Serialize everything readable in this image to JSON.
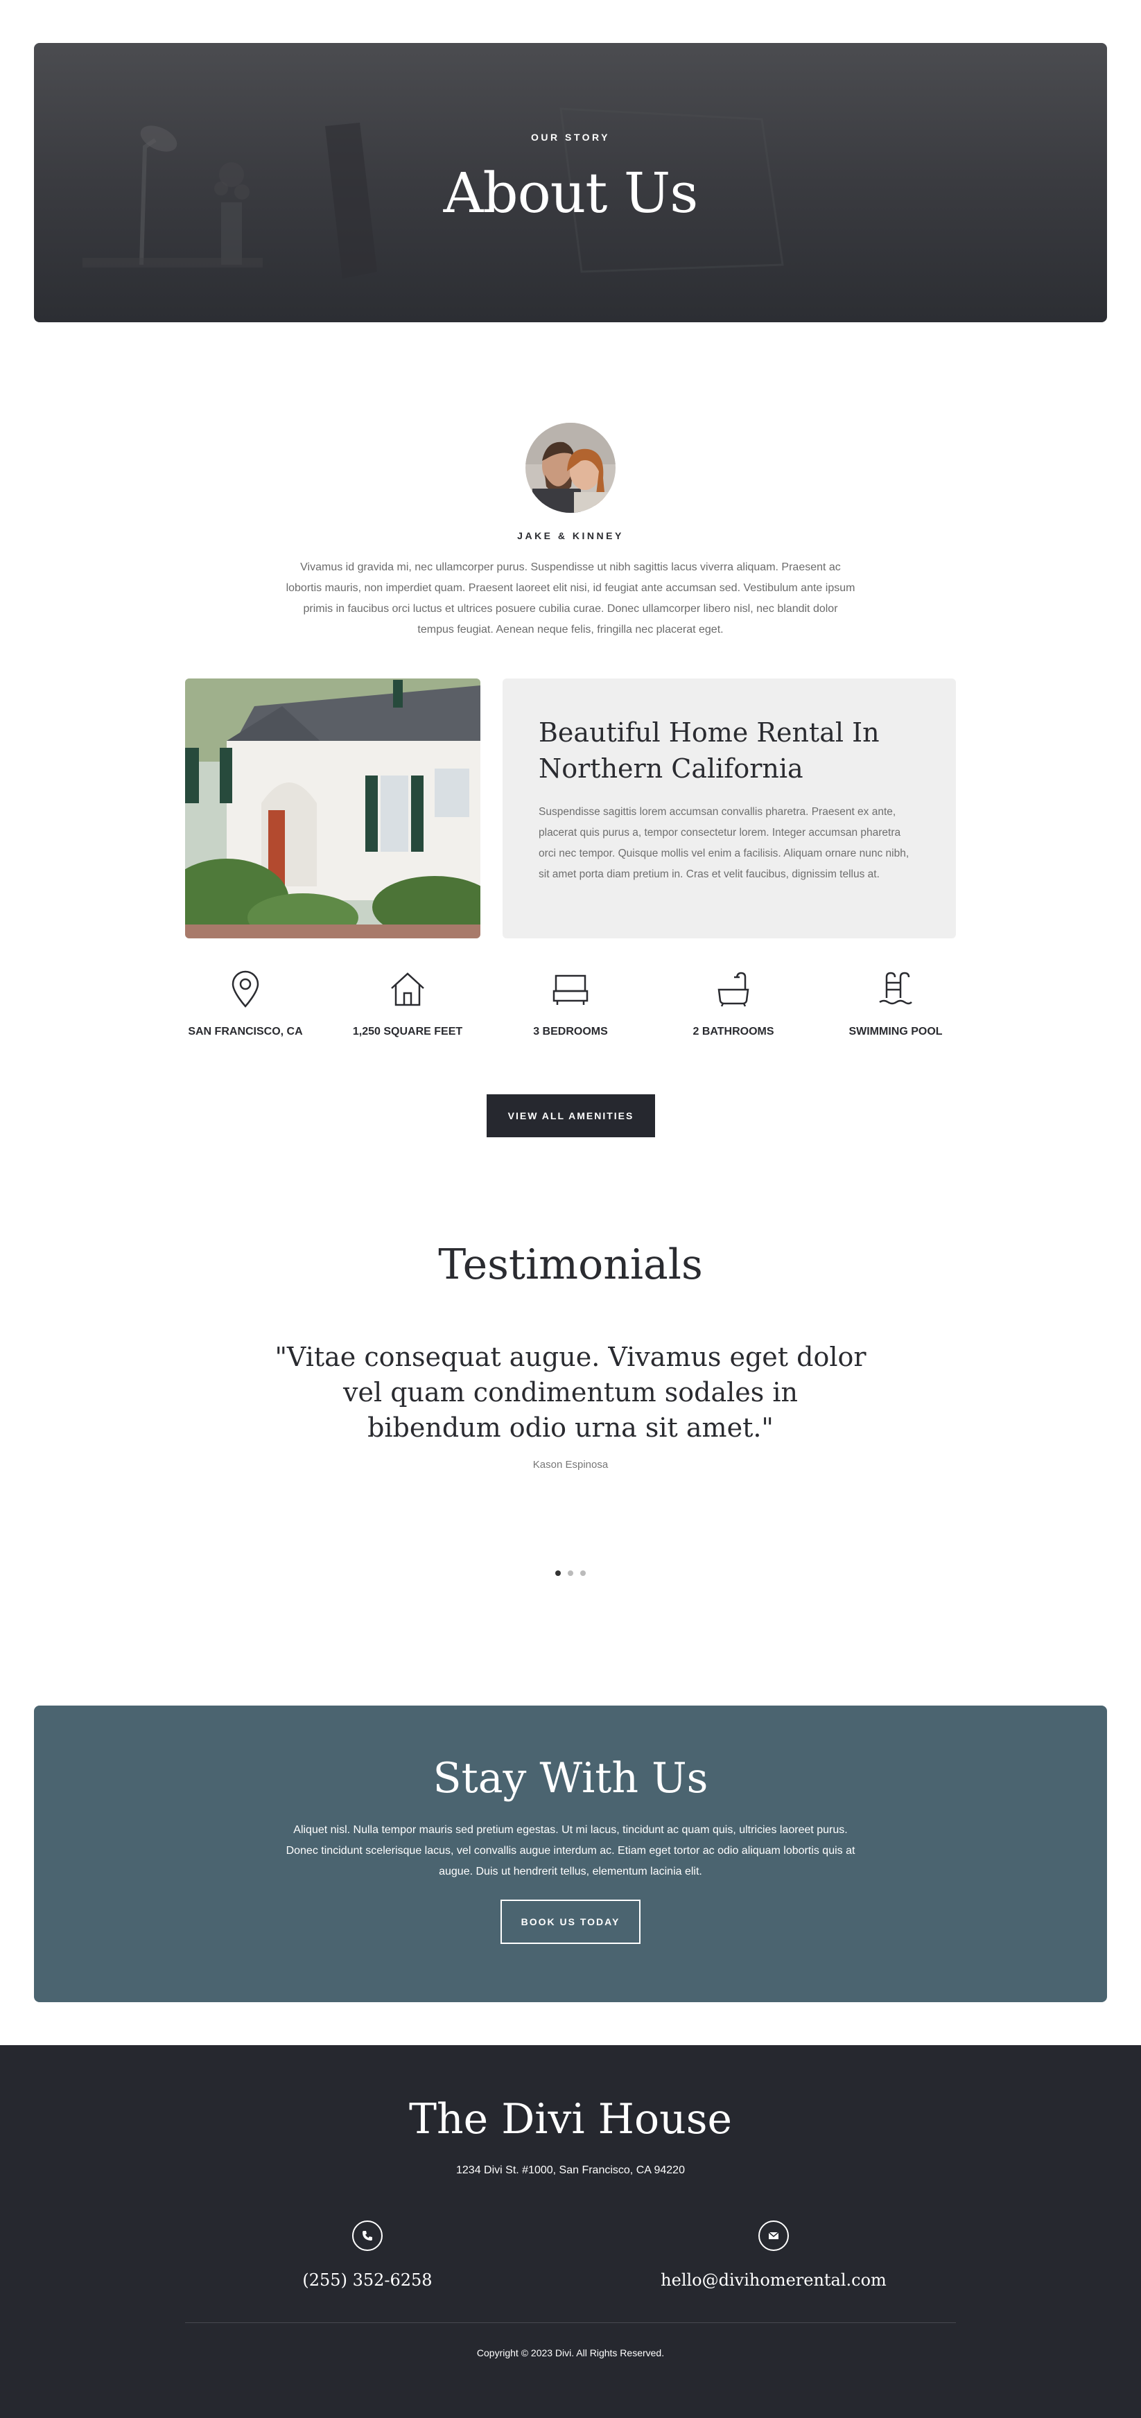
{
  "hero": {
    "eyebrow": "OUR STORY",
    "title": "About Us"
  },
  "profile": {
    "names": "JAKE & KINNEY",
    "intro": "Vivamus id gravida mi, nec ullamcorper purus. Suspendisse ut nibh sagittis lacus viverra aliquam. Praesent ac lobortis mauris, non imperdiet quam. Praesent laoreet elit nisi, id feugiat ante accumsan sed. Vestibulum ante ipsum primis in faucibus orci luctus et ultrices posuere cubilia curae. Donec ullamcorper libero nisl, nec blandit dolor tempus feugiat. Aenean neque felis, fringilla nec placerat eget."
  },
  "listing": {
    "title": "Beautiful Home Rental In Northern California",
    "text": "Suspendisse sagittis lorem accumsan convallis pharetra. Praesent ex ante, placerat quis purus a, tempor consectetur lorem. Integer accumsan pharetra orci nec tempor. Quisque mollis vel enim a facilisis. Aliquam ornare nunc nibh, sit amet porta diam pretium in. Cras et velit faucibus, dignissim tellus at."
  },
  "features": [
    {
      "label": "SAN FRANCISCO, CA",
      "icon": "location-pin-icon"
    },
    {
      "label": "1,250 SQUARE FEET",
      "icon": "house-icon"
    },
    {
      "label": "3 BEDROOMS",
      "icon": "bed-icon"
    },
    {
      "label": "2 BATHROOMS",
      "icon": "bathtub-icon"
    },
    {
      "label": "SWIMMING POOL",
      "icon": "pool-ladder-icon"
    }
  ],
  "amenities_button": "VIEW ALL AMENITIES",
  "testimonials": {
    "title": "Testimonials",
    "quote": "\"Vitae consequat augue. Vivamus eget dolor vel quam condimentum sodales in bibendum odio urna sit amet.\"",
    "author": "Kason Espinosa"
  },
  "stay": {
    "title": "Stay With Us",
    "text": "Aliquet nisl. Nulla tempor mauris sed pretium egestas. Ut mi lacus, tincidunt ac quam quis, ultricies laoreet purus. Donec tincidunt scelerisque lacus, vel convallis augue interdum ac. Etiam eget tortor ac odio aliquam lobortis quis at augue. Duis ut hendrerit tellus, elementum lacinia elit.",
    "button": "BOOK US TODAY"
  },
  "footer": {
    "title": "The Divi House",
    "address": "1234 Divi St. #1000, San Francisco, CA 94220",
    "phone": "(255) 352-6258",
    "email": "hello@divihomerental.com",
    "copyright": "Copyright © 2023 Divi. All Rights Reserved."
  },
  "colors": {
    "dark": "#26282f",
    "teal": "#4b6470",
    "card": "#efefef"
  }
}
